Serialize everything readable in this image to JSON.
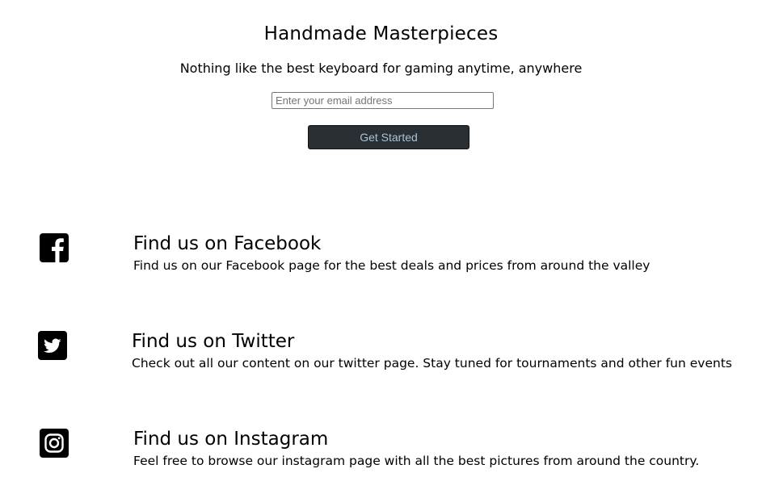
{
  "hero": {
    "title": "Handmade Masterpieces",
    "subtitle": "Nothing like the best keyboard for gaming anytime, anywhere",
    "email_placeholder": "Enter your email address",
    "email_value": "",
    "button_label": "Get Started"
  },
  "social": [
    {
      "icon": "facebook-icon",
      "heading": "Find us on Facebook",
      "description": "Find us on our Facebook page for the best deals and prices from around the valley"
    },
    {
      "icon": "twitter-icon",
      "heading": "Find us on Twitter",
      "description": "Check out all our content on our twitter page. Stay tuned for tournaments and other fun events"
    },
    {
      "icon": "instagram-icon",
      "heading": "Find us on Instagram",
      "description": "Feel free to browse our instagram page with all the best pictures from around the country."
    }
  ],
  "colors": {
    "button_bg": "#2a2f33",
    "button_text": "#a9c2d8",
    "icon": "#000000"
  }
}
